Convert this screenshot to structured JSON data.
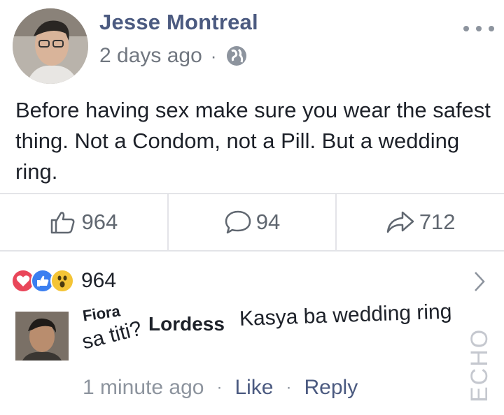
{
  "post": {
    "author": "Jesse Montreal",
    "timestamp": "2 days ago",
    "separator": "·",
    "privacy_icon": "globe-icon",
    "more_icon": "more-horizontal-icon",
    "body": "Before having sex make sure you wear the safest thing. Not a Condom, not a Pill. But a wedding ring."
  },
  "actions": {
    "like_count": "964",
    "comment_count": "94",
    "share_count": "712",
    "like_icon": "thumbs-up-icon",
    "comment_icon": "speech-bubble-icon",
    "share_icon": "share-arrow-icon"
  },
  "reactions": {
    "types": [
      "love",
      "like",
      "wow"
    ],
    "count": "964",
    "colors": {
      "love": "#e9465a",
      "like": "#3b7ff0",
      "wow": "#f4c436"
    }
  },
  "comment": {
    "author_first": "Fiora",
    "author_last": "Lordess",
    "text_line1": "Kasya ba wedding ring",
    "text_line2": "sa titi?",
    "time": "1 minute ago",
    "like_label": "Like",
    "reply_label": "Reply",
    "separator": "·"
  },
  "watermark": "ECHO",
  "colors": {
    "name_blue": "#4b5a80",
    "meta_gray": "#717780",
    "divider": "#e3e4e8"
  }
}
